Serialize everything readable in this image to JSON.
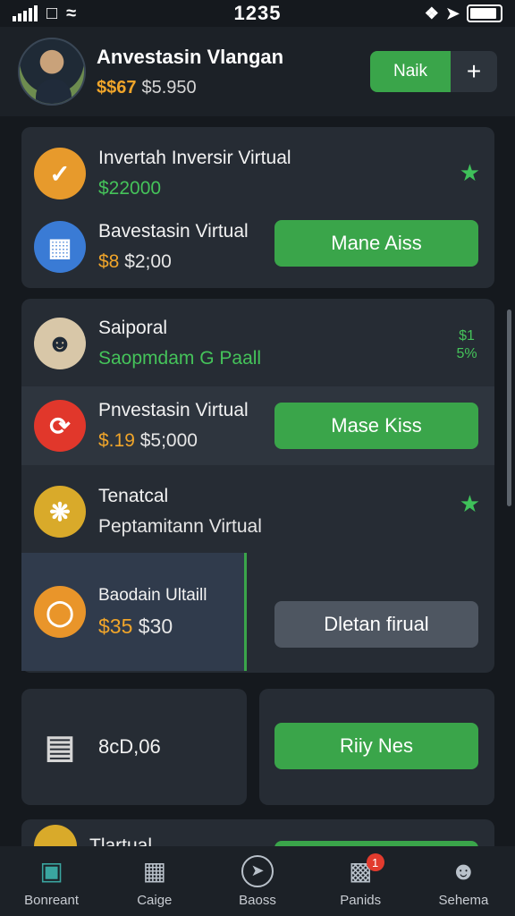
{
  "status": {
    "time": "1235"
  },
  "header": {
    "title": "Anvestasin Vlangan",
    "balance_gold": "$$67",
    "balance": "$5.950",
    "primary_button": "Naik",
    "plus_icon": "+"
  },
  "card1": {
    "row1": {
      "title": "Invertah Inversir Virtual",
      "value": "$22000"
    },
    "row2": {
      "title": "Bavestasin Virtual",
      "value_prefix": "$8",
      "value": "$2;00",
      "button": "Mane Aiss"
    }
  },
  "card2": {
    "row1": {
      "title": "Saiporal",
      "subtitle": "Saopmdam G Paall",
      "side": "$1 5%"
    },
    "row2": {
      "title": "Pnvestasin Virtual",
      "value_prefix": "$.19",
      "value": "$5;000",
      "button": "Mase Kiss"
    },
    "row3": {
      "title": "Tenatcal",
      "subtitle": "Peptamitann Virtual"
    },
    "row4": {
      "title": "Baodain Ultaill",
      "value_prefix": "$35",
      "value": "$30",
      "button": "Dletan firual"
    }
  },
  "card3": {
    "value": "8cD,06",
    "button": "Riiy Nes"
  },
  "card4": {
    "title": "Tlartual"
  },
  "nav": {
    "items": [
      {
        "label": "Bonreant",
        "icon": "home-icon"
      },
      {
        "label": "Caige",
        "icon": "store-icon"
      },
      {
        "label": "Baoss",
        "icon": "compass-icon"
      },
      {
        "label": "Panids",
        "icon": "wallet-icon",
        "badge": "1"
      },
      {
        "label": "Sehema",
        "icon": "profile-icon"
      }
    ]
  },
  "colors": {
    "accent": "#3aa54a",
    "background": "#15191e",
    "card": "#262c34",
    "gold": "#f0a52a"
  }
}
